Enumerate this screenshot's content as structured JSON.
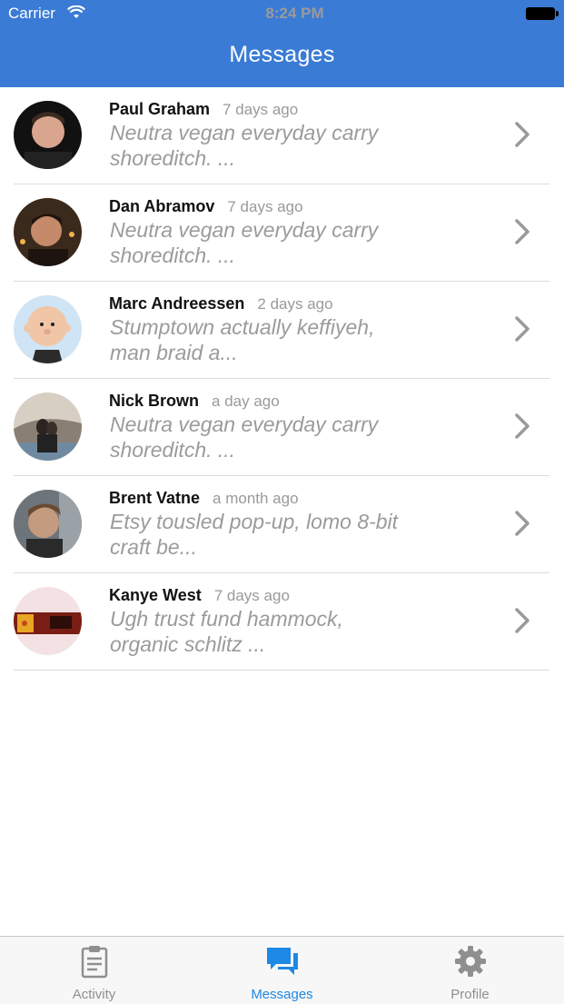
{
  "status_bar": {
    "carrier": "Carrier",
    "time": "8:24 PM"
  },
  "header": {
    "title": "Messages"
  },
  "messages": [
    {
      "name": "Paul Graham",
      "time": "7 days ago",
      "preview": "Neutra vegan everyday carry shoreditch. ..."
    },
    {
      "name": "Dan Abramov",
      "time": "7 days ago",
      "preview": "Neutra vegan everyday carry shoreditch. ..."
    },
    {
      "name": "Marc Andreessen",
      "time": "2 days ago",
      "preview": "Stumptown actually keffiyeh, man braid a..."
    },
    {
      "name": "Nick Brown",
      "time": "a day ago",
      "preview": "Neutra vegan everyday carry shoreditch. ..."
    },
    {
      "name": "Brent Vatne",
      "time": "a month ago",
      "preview": "Etsy tousled pop-up, lomo 8-bit craft be..."
    },
    {
      "name": "Kanye West",
      "time": "7 days ago",
      "preview": "Ugh trust fund hammock, organic schlitz ..."
    }
  ],
  "tabs": [
    {
      "label": "Activity",
      "icon": "clipboard-icon"
    },
    {
      "label": "Messages",
      "icon": "chat-bubbles-icon"
    },
    {
      "label": "Profile",
      "icon": "gear-icon"
    }
  ],
  "colors": {
    "accent": "#3a7bd5",
    "active_tab": "#1e88e5",
    "muted_text": "#9b9b9b"
  }
}
